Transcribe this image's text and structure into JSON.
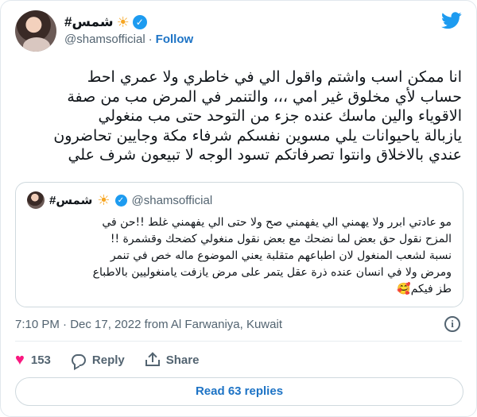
{
  "author": {
    "name": "#شمس",
    "handle": "@shamsofficial",
    "separator": "·",
    "follow_label": "Follow"
  },
  "icons": {
    "sun": "☀",
    "verified": "✓",
    "twitter": "twitter-bird-icon",
    "heart": "♥",
    "reply": "reply-bubble-icon",
    "share": "share-upload-icon",
    "info": "i"
  },
  "tweet": {
    "lines": [
      "انا ممكن اسب واشتم واقول الي في خاطري  ولا عمري احط",
      "حساب لأي مخلوق غير امي ،،، والتنمر  في المرض مب من صفة",
      "الاقوياء والين ماسك عنده جزء من التوحد حتى مب منغولي",
      "يازبالة ياحيوانات يلي مسوين نفسكم شرفاء مكة وجايين تحاضرون",
      "عندي بالاخلاق وانتوا تصرفاتكم تسود الوجه لا تبيعون شرف علي"
    ]
  },
  "quoted": {
    "name": "#شمس",
    "handle": "@shamsofficial",
    "lines": [
      "مو عادتي ابرر ولا يهمني الي يفهمني صح ولا حتى الي يفهمني غلط !!حن في",
      "المزح نقول حق بعض  لما نضحك مع بعض نقول منغولي  كضحك وقشمرة !!",
      "نسبة لشعب المنغول لان اطباعهم متقلبة يعني الموضوع ماله خص في تنمر",
      "ومرض ولا في انسان عنده ذرة عقل يتمر على مرض يازفت يامنغوليين بالاطباع",
      "طز فيكم🥰"
    ]
  },
  "meta": {
    "timestamp": "7:10 PM · Dec 17, 2022 from Al Farwaniya, Kuwait"
  },
  "actions": {
    "likes": "153",
    "reply_label": "Reply",
    "share_label": "Share"
  },
  "read_replies_label": "Read 63 replies",
  "colors": {
    "accent": "#1d9bf0",
    "link": "#1d73c5",
    "heart": "#f91880",
    "muted": "#536471"
  }
}
